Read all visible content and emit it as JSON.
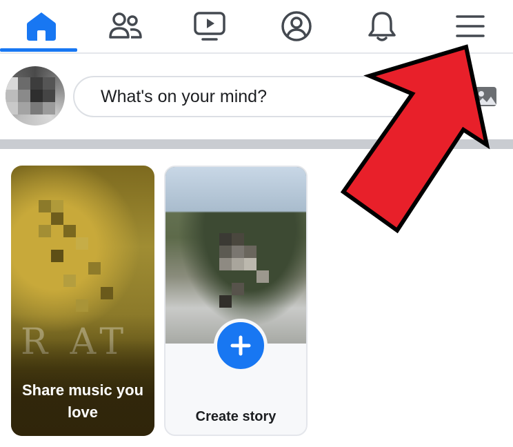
{
  "nav": {
    "items": [
      {
        "name": "home",
        "icon": "home-icon",
        "active": true
      },
      {
        "name": "friends",
        "icon": "friends-icon",
        "active": false
      },
      {
        "name": "watch",
        "icon": "video-icon",
        "active": false
      },
      {
        "name": "profile",
        "icon": "profile-icon",
        "active": false
      },
      {
        "name": "notifications",
        "icon": "bell-icon",
        "active": false
      },
      {
        "name": "menu",
        "icon": "hamburger-menu-icon",
        "active": false
      }
    ],
    "active_color": "#1877f2",
    "icon_color": "#444950"
  },
  "composer": {
    "placeholder": "What's on your mind?",
    "photo_icon": "photo-icon"
  },
  "stories": [
    {
      "label": "Share music you love",
      "deco_text": "R AT"
    },
    {
      "label": "Create story",
      "action_icon": "plus-icon"
    }
  ],
  "annotation": {
    "arrow_color": "#e8202a",
    "arrow_icon": "red-arrow-icon"
  }
}
